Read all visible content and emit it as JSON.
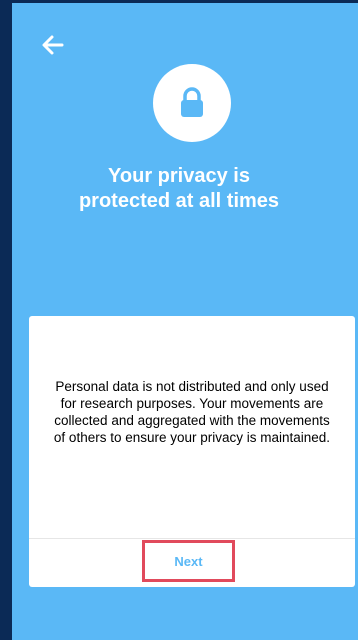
{
  "header": {
    "back_icon": "arrow-left-icon"
  },
  "hero": {
    "icon": "lock-icon",
    "title_line1": "Your privacy is",
    "title_line2": "protected at all times"
  },
  "card": {
    "body_text": "Personal data is not distributed and only used for research purposes. Your movements are collected and aggregated with the movements of others to ensure your privacy is maintained.",
    "next_label": "Next"
  },
  "colors": {
    "screen_background": "#5ab8f6",
    "outer_background": "#0b2a56",
    "card_background": "#ffffff",
    "next_text": "#5ab8f6",
    "highlight_border": "#e14a5c"
  }
}
